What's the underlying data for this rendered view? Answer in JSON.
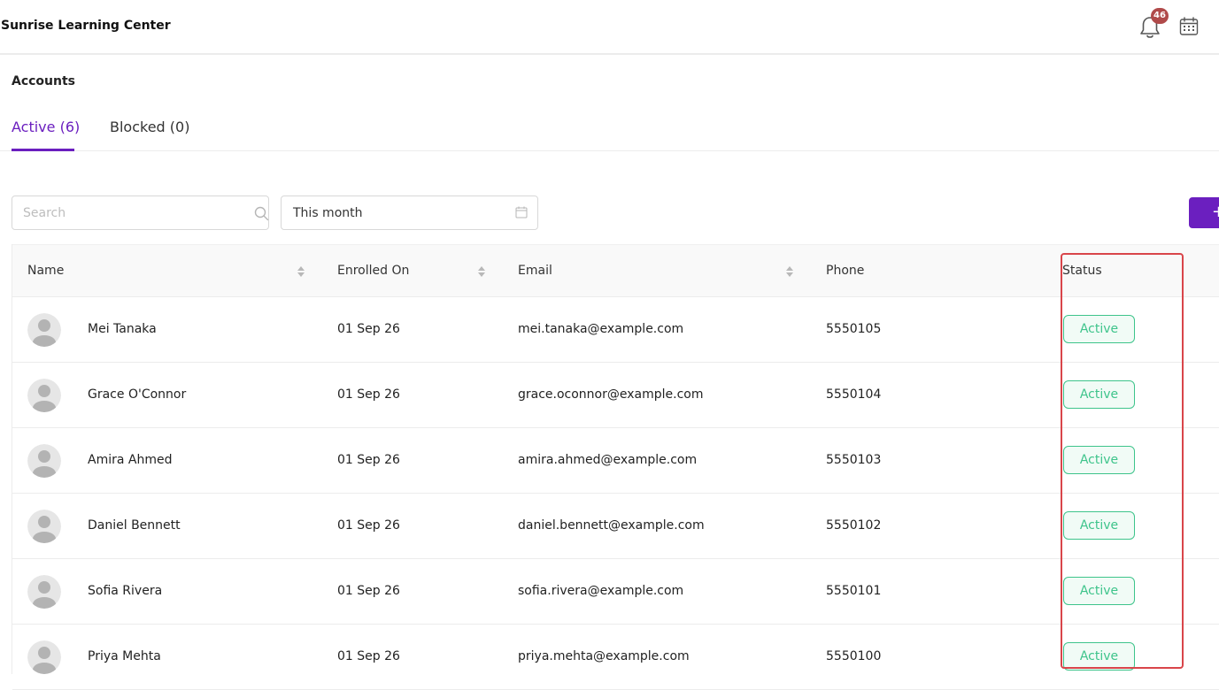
{
  "colors": {
    "accent": "#6b1fbf",
    "badge": "#b04a4a",
    "status_green": "#3ec48b",
    "highlight": "#d9454a",
    "avatar_bg": "#e6e6e6",
    "avatar_fg": "#b3b3b3"
  },
  "header": {
    "brand": "Sunrise Learning Center",
    "notification_count": "46",
    "icons": [
      "bell-icon",
      "calendar-icon"
    ]
  },
  "page": {
    "heading": "Accounts"
  },
  "tabs": [
    {
      "label": "Active (6)",
      "active": true
    },
    {
      "label": "Blocked (0)",
      "active": false
    }
  ],
  "filters": {
    "search_placeholder": "Search",
    "date_range": "This month",
    "add_label": "+"
  },
  "table": {
    "columns": [
      "Name",
      "Enrolled On",
      "Email",
      "Phone",
      "Status"
    ],
    "rows": [
      {
        "name": "Mei Tanaka",
        "enrolled": "01 Sep 26",
        "email": "mei.tanaka@example.com",
        "phone": "5550105",
        "status": "Active"
      },
      {
        "name": "Grace O'Connor",
        "enrolled": "01 Sep 26",
        "email": "grace.oconnor@example.com",
        "phone": "5550104",
        "status": "Active"
      },
      {
        "name": "Amira Ahmed",
        "enrolled": "01 Sep 26",
        "email": "amira.ahmed@example.com",
        "phone": "5550103",
        "status": "Active"
      },
      {
        "name": "Daniel Bennett",
        "enrolled": "01 Sep 26",
        "email": "daniel.bennett@example.com",
        "phone": "5550102",
        "status": "Active"
      },
      {
        "name": "Sofia Rivera",
        "enrolled": "01 Sep 26",
        "email": "sofia.rivera@example.com",
        "phone": "5550101",
        "status": "Active"
      },
      {
        "name": "Priya Mehta",
        "enrolled": "01 Sep 26",
        "email": "priya.mehta@example.com",
        "phone": "5550100",
        "status": "Active"
      }
    ]
  }
}
